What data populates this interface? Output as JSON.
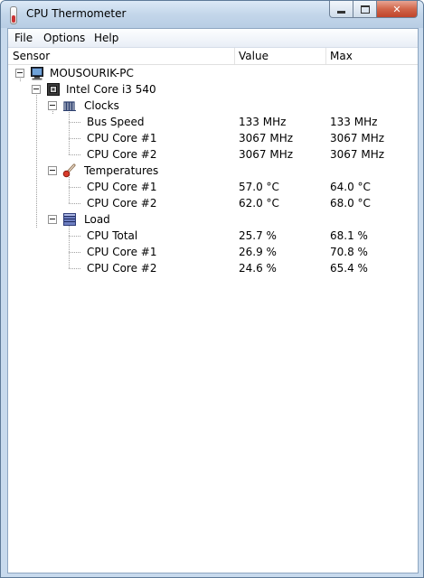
{
  "window": {
    "title": "CPU Thermometer"
  },
  "menu": [
    "File",
    "Options",
    "Help"
  ],
  "columns": {
    "sensor": "Sensor",
    "value": "Value",
    "max": "Max"
  },
  "tree": {
    "computer": "MOUSOURIK-PC",
    "cpu": "Intel Core i3 540",
    "groups": [
      {
        "name": "Clocks",
        "icon": "clock-icon",
        "items": [
          {
            "name": "Bus Speed",
            "value": "133 MHz",
            "max": "133 MHz"
          },
          {
            "name": "CPU Core #1",
            "value": "3067 MHz",
            "max": "3067 MHz"
          },
          {
            "name": "CPU Core #2",
            "value": "3067 MHz",
            "max": "3067 MHz"
          }
        ]
      },
      {
        "name": "Temperatures",
        "icon": "thermometer-icon",
        "items": [
          {
            "name": "CPU Core #1",
            "value": "57.0 °C",
            "max": "64.0 °C"
          },
          {
            "name": "CPU Core #2",
            "value": "62.0 °C",
            "max": "68.0 °C"
          }
        ]
      },
      {
        "name": "Load",
        "icon": "load-icon",
        "items": [
          {
            "name": "CPU Total",
            "value": "25.7 %",
            "max": "68.1 %"
          },
          {
            "name": "CPU Core #1",
            "value": "26.9 %",
            "max": "70.8 %"
          },
          {
            "name": "CPU Core #2",
            "value": "24.6 %",
            "max": "65.4 %"
          }
        ]
      }
    ]
  }
}
